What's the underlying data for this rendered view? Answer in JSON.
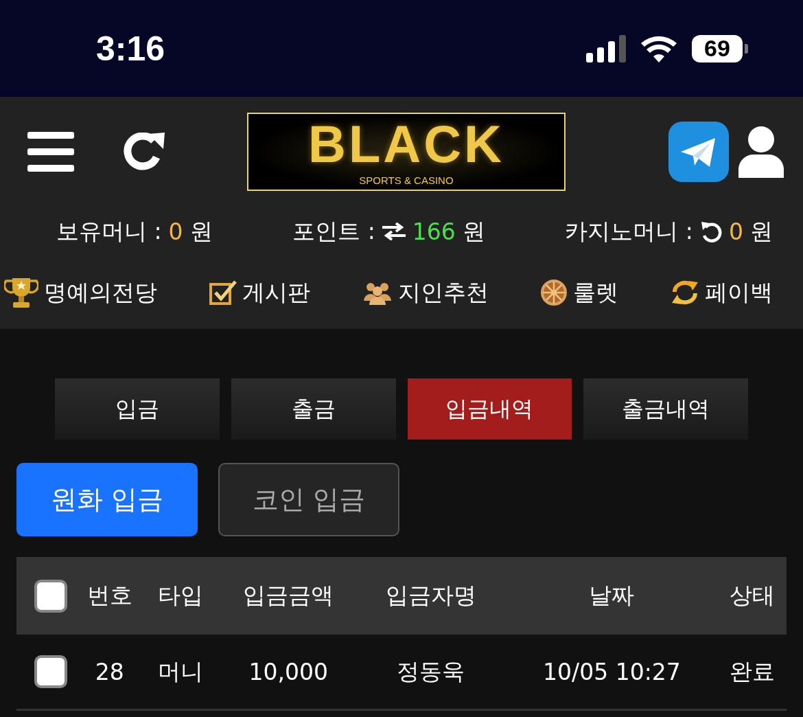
{
  "status_bar": {
    "time": "3:16",
    "battery": "69"
  },
  "header": {
    "logo": {
      "title": "BLACK",
      "subtitle": "SPORTS & CASINO"
    }
  },
  "balances": [
    {
      "label": "보유머니 :",
      "kind": "plain",
      "value": "0",
      "color": "#f2b54a",
      "unit": "원"
    },
    {
      "label": "포인트 :",
      "kind": "exchange",
      "value": "166",
      "color": "#4fdc4f",
      "unit": "원"
    },
    {
      "label": "카지노머니 :",
      "kind": "refresh",
      "value": "0",
      "color": "#f2b54a",
      "unit": "원"
    }
  ],
  "menu": [
    {
      "label": "명예의전당",
      "kind": "trophy"
    },
    {
      "label": "게시판",
      "kind": "board"
    },
    {
      "label": "지인추천",
      "kind": "people"
    },
    {
      "label": "룰렛",
      "kind": "wheel"
    },
    {
      "label": "페이백",
      "kind": "cycle"
    }
  ],
  "tabs": [
    {
      "label": "입금",
      "selected": false
    },
    {
      "label": "출금",
      "selected": false
    },
    {
      "label": "입금내역",
      "selected": true
    },
    {
      "label": "출금내역",
      "selected": false
    }
  ],
  "sub_tabs": [
    {
      "label": "원화 입금",
      "selected": true
    },
    {
      "label": "코인 입금",
      "selected": false
    }
  ],
  "table": {
    "select_all_checked": false,
    "columns": [
      "번호",
      "타입",
      "입금금액",
      "입금자명",
      "날짜",
      "상태"
    ],
    "rows": [
      {
        "checked": false,
        "cells": [
          "28",
          "머니",
          "10,000",
          "정동욱",
          "10/05 10:27",
          "완료"
        ]
      }
    ]
  }
}
